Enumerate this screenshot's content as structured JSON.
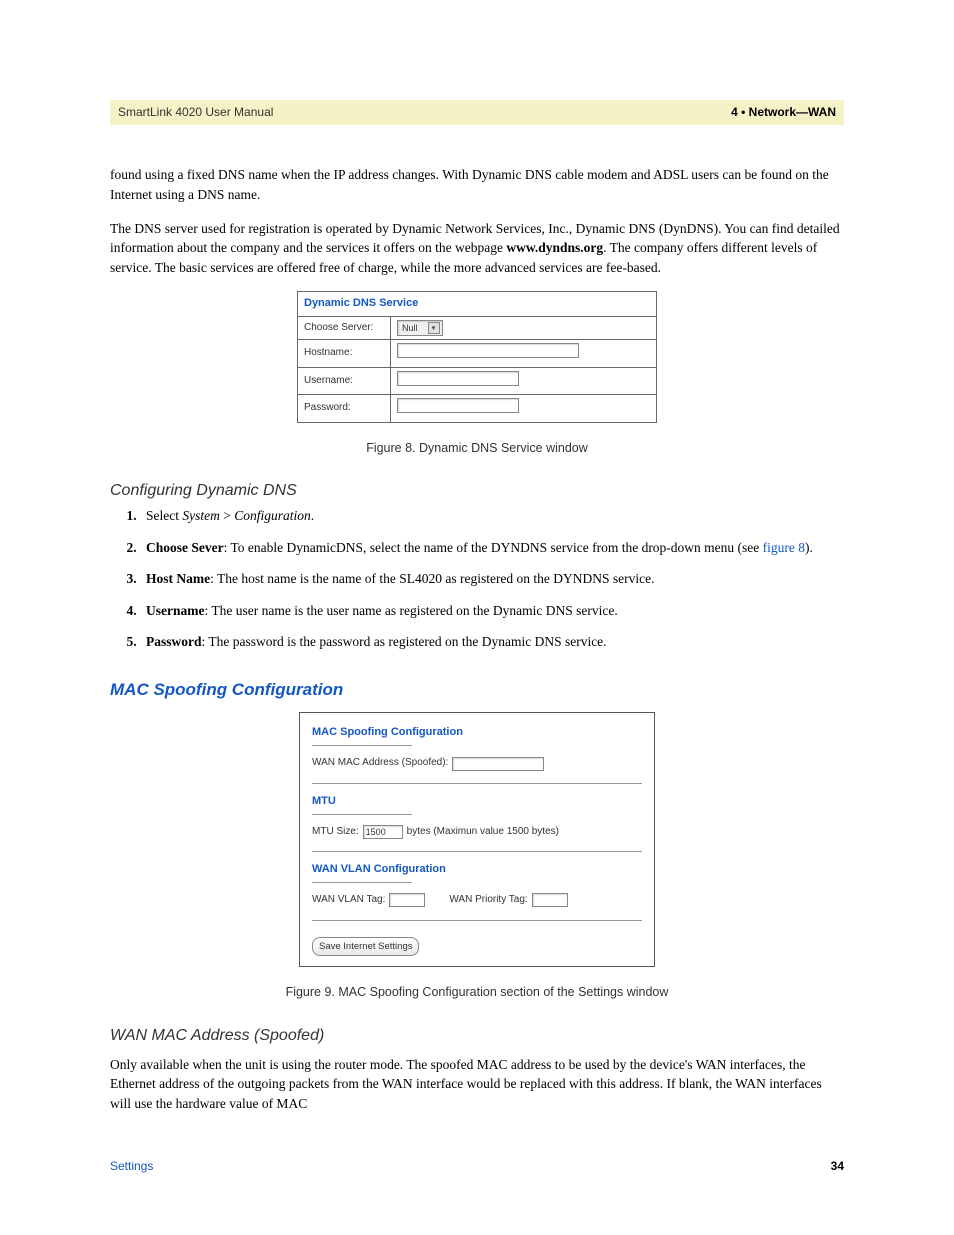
{
  "banner": {
    "left": "SmartLink 4020 User Manual",
    "right": "4 • Network—WAN"
  },
  "para1": "found using a fixed DNS name when the IP address changes. With Dynamic DNS cable modem and ADSL users can be found on the Internet using a DNS name.",
  "para2_a": "The DNS server used for registration is operated by Dynamic Network Services, Inc., Dynamic DNS (DynDNS). You can find detailed information about the company and the services it offers on the webpage ",
  "para2_b": "www.dyndns.org",
  "para2_c": ". The company offers different levels of service. The basic services are offered free of charge, while the more advanced services are fee-based.",
  "fig8": {
    "title": "Dynamic DNS Service",
    "rows": {
      "choose_server": "Choose Server:",
      "hostname": "Hostname:",
      "username": "Username:",
      "password": "Password:"
    },
    "select_value": "Null",
    "caption": "Figure 8. Dynamic DNS Service window"
  },
  "h_config_dyn": "Configuring Dynamic DNS",
  "steps": {
    "s1_a": "Select ",
    "s1_b": "System",
    "s1_c": " > ",
    "s1_d": "Configuration",
    "s1_e": ".",
    "s2_label": "Choose Sever",
    "s2_a": ": To enable DynamicDNS, select the name of the DYNDNS service from the drop-down menu (see ",
    "s2_link": "figure 8",
    "s2_b": ").",
    "s3_label": "Host Name",
    "s3_a": ": The host name is the name of the SL4020 as registered on the DYNDNS service.",
    "s4_label": "Username",
    "s4_a": ": The user name is the user name as registered on the Dynamic DNS service.",
    "s5_label": "Password",
    "s5_a": ": The password is the password as registered on the Dynamic DNS service."
  },
  "h_mac_spoof": "MAC Spoofing Configuration",
  "fig9": {
    "title1": "MAC Spoofing Configuration",
    "row1": "WAN MAC Address (Spoofed):",
    "title2": "MTU",
    "row2_a": "MTU Size:",
    "row2_value": "1500",
    "row2_b": "bytes (Maximun value 1500 bytes)",
    "title3": "WAN VLAN Configuration",
    "row3_a": "WAN VLAN Tag:",
    "row3_b": "WAN Priority Tag:",
    "button": "Save Internet Settings",
    "caption": "Figure 9. MAC Spoofing Configuration section of the Settings window"
  },
  "h_wan_mac": "WAN MAC Address (Spoofed)",
  "para3": "Only available when the unit is using the router mode. The spoofed MAC address to be used by the device's WAN interfaces, the Ethernet address of the outgoing packets from the WAN interface would be replaced with this address. If blank, the WAN interfaces will use the hardware value of MAC",
  "footer": {
    "left": "Settings",
    "right": "34"
  }
}
